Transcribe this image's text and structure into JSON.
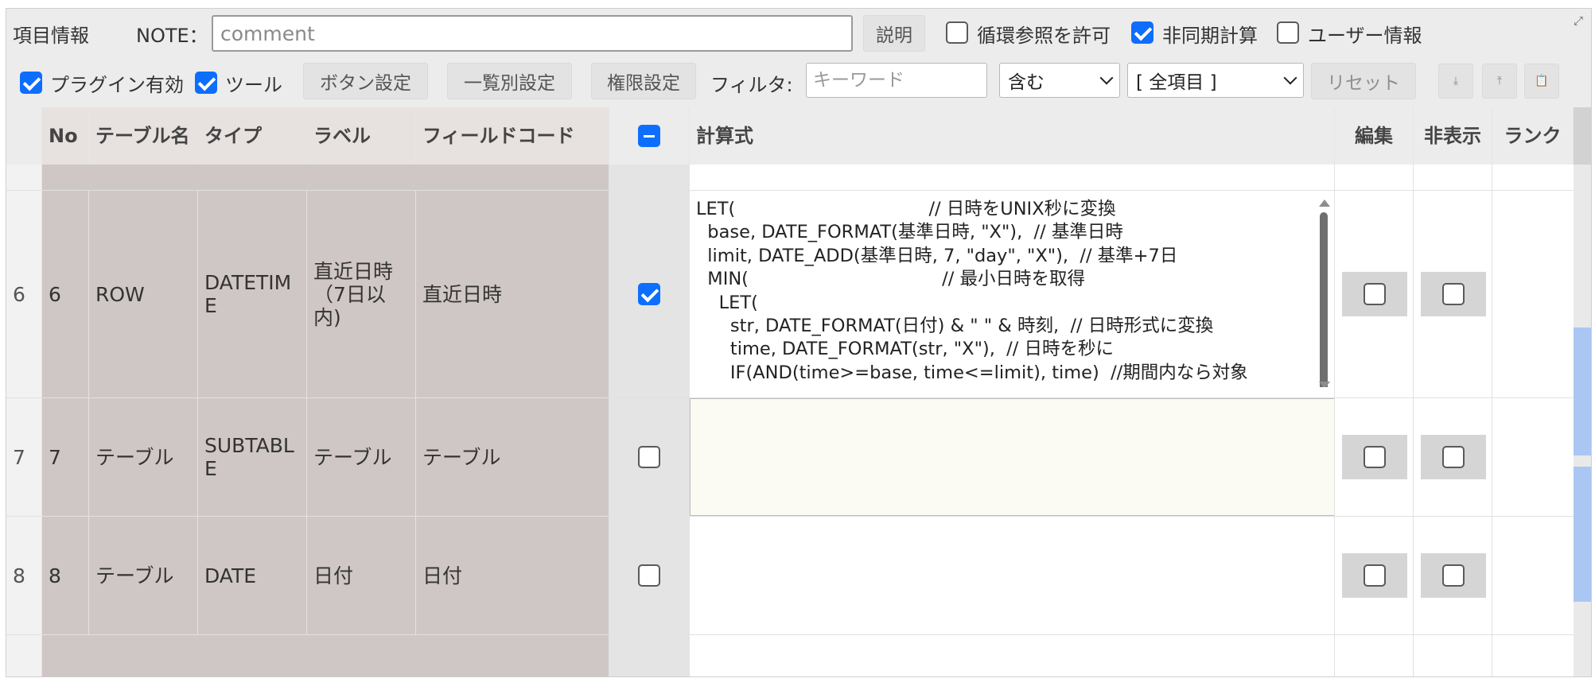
{
  "toolbar": {
    "title": "項目情報",
    "note_label": "NOTE：",
    "note_placeholder": "comment",
    "explain_button": "説明",
    "circular_ref_label": "循環参照を許可",
    "circular_ref_checked": false,
    "async_calc_label": "非同期計算",
    "async_calc_checked": true,
    "user_info_label": "ユーザー情報",
    "user_info_checked": false,
    "plugin_enabled_label": "プラグイン有効",
    "plugin_enabled_checked": true,
    "tool_label": "ツール",
    "tool_checked": true,
    "button_settings": "ボタン設定",
    "list_settings": "一覧別設定",
    "permission_settings": "権限設定",
    "filter_label": "フィルタ:",
    "keyword_placeholder": "キーワード",
    "match_select": "含む",
    "field_select": "[ 全項目 ]",
    "reset_button": "リセット",
    "icons": [
      "download-icon",
      "upload-icon",
      "clipboard-icon",
      "expand-icon"
    ]
  },
  "table": {
    "headers": {
      "no": "No",
      "table_name": "テーブル名",
      "type": "タイプ",
      "label": "ラベル",
      "field_code": "フィールドコード",
      "formula": "計算式",
      "edit": "編集",
      "hidden": "非表示",
      "rank": "ランク"
    },
    "select_all_state": "indeterminate",
    "rows": [
      {
        "index": "6",
        "no": "6",
        "table_name": "ROW",
        "type": "DATETIME",
        "label": "直近日時（7日以内)",
        "field_code": "直近日時",
        "checked": true,
        "formula": "LET(                                  // 日時をUNIX秒に変換\n  base, DATE_FORMAT(基準日時, \"X\"),  // 基準日時\n  limit, DATE_ADD(基準日時, 7, \"day\", \"X\"),  // 基準+7日\n  MIN(                                  // 最小日時を取得\n    LET(\n      str, DATE_FORMAT(日付) & \" \" & 時刻,  // 日時形式に変換\n      time, DATE_FORMAT(str, \"X\"),  // 日時を秒に\n      IF(AND(time>=base, time<=limit), time)  //期間内なら対象\n    )\n  )\n`",
        "edit_checked": false,
        "hidden_checked": false
      },
      {
        "index": "7",
        "no": "7",
        "table_name": "テーブル",
        "type": "SUBTABLE",
        "label": "テーブル",
        "field_code": "テーブル",
        "checked": false,
        "formula": "",
        "edit_checked": false,
        "hidden_checked": false
      },
      {
        "index": "8",
        "no": "8",
        "table_name": "テーブル",
        "type": "DATE",
        "label": "日付",
        "field_code": "日付",
        "checked": false,
        "formula": "",
        "edit_checked": false,
        "hidden_checked": false
      }
    ]
  }
}
